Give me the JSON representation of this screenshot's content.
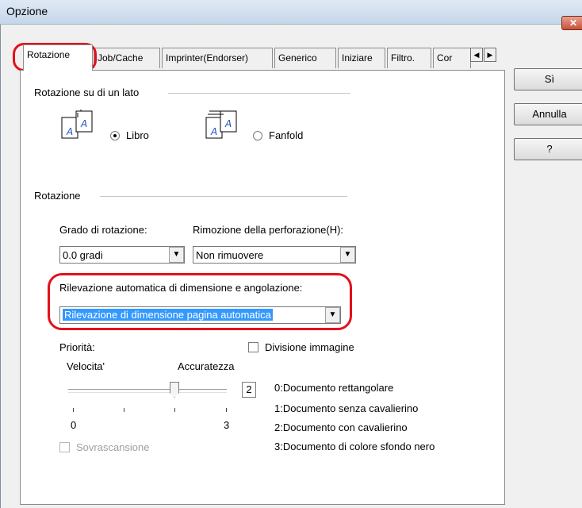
{
  "window": {
    "title": "Opzione"
  },
  "tabs": [
    "Rotazione",
    "Job/Cache",
    "Imprinter(Endorser)",
    "Generico",
    "Iniziare",
    "Filtro.",
    "Cor"
  ],
  "buttons": {
    "ok": "Sì",
    "cancel": "Annulla",
    "help": "?"
  },
  "side_rotation": {
    "label": "Rotazione su di un lato",
    "option_book": "Libro",
    "option_fanfold": "Fanfold"
  },
  "rotation": {
    "label": "Rotazione",
    "degree_label": "Grado di rotazione:",
    "degree_value": "0.0 gradi",
    "punch_label": "Rimozione della perforazione(H):",
    "punch_value": "Non rimuovere",
    "auto_label": "Rilevazione automatica di dimensione e angolazione:",
    "auto_value": "Rilevazione di dimensione pagina automatica"
  },
  "priority": {
    "label": "Priorità:",
    "speed": "Velocita'",
    "accuracy": "Accuratezza",
    "min": "0",
    "max": "3",
    "value": "2",
    "legend": [
      "0:Documento rettangolare",
      "1:Documento senza cavalierino",
      "2:Documento con cavalierino",
      "3:Documento di colore sfondo nero"
    ],
    "overscan": "Sovrascansione",
    "split_image": "Divisione immagine"
  },
  "icons": {
    "close": "close-icon",
    "scroll_left": "arrow-left-icon",
    "scroll_right": "arrow-right-icon"
  }
}
